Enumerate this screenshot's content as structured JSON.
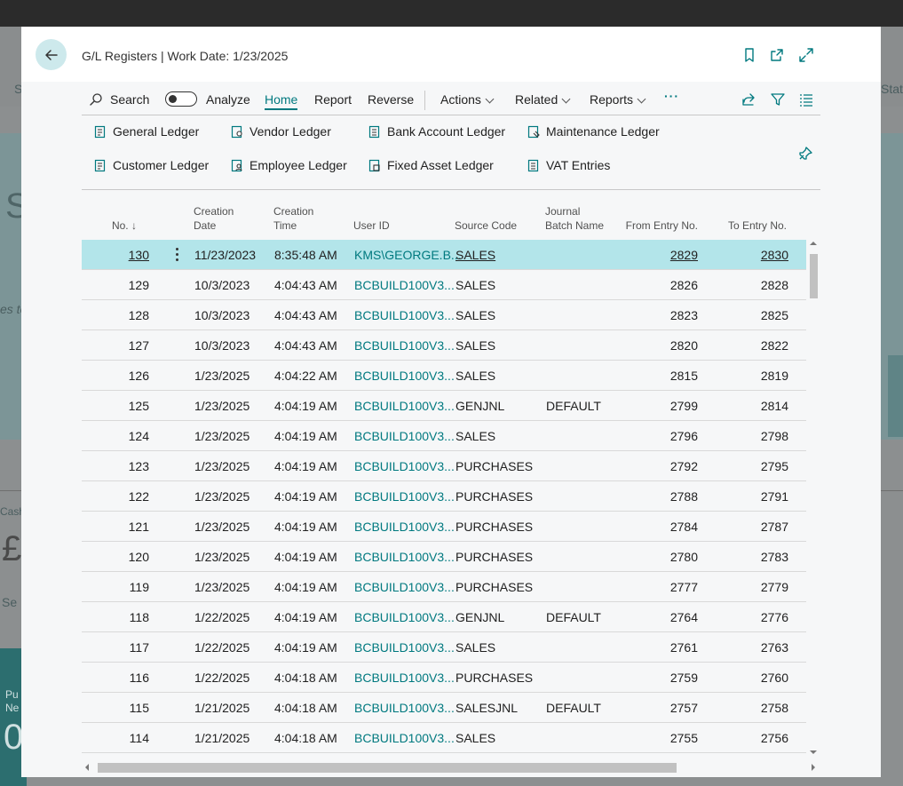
{
  "modal": {
    "title": "G/L Registers | Work Date: 1/23/2025"
  },
  "background": {
    "items": [
      "St",
      "Stat",
      "S",
      "es to",
      "Cash",
      "£",
      "Se",
      "Pu",
      "Ne",
      "0"
    ]
  },
  "actions": {
    "search": "Search",
    "analyze": "Analyze",
    "tabs": [
      "Home",
      "Report",
      "Reverse"
    ],
    "menus": [
      "Actions",
      "Related",
      "Reports"
    ],
    "more": "···"
  },
  "promoted": [
    "General Ledger",
    "Vendor Ledger",
    "Bank Account Ledger",
    "Maintenance Ledger",
    "Customer Ledger",
    "Employee Ledger",
    "Fixed Asset Ledger",
    "VAT Entries"
  ],
  "columns": {
    "no": "No.",
    "sort_indicator": "↓",
    "creation_date": [
      "Creation",
      "Date"
    ],
    "creation_time": [
      "Creation",
      "Time"
    ],
    "user_id": "User ID",
    "source_code": "Source Code",
    "journal_batch": [
      "Journal",
      "Batch Name"
    ],
    "from_entry": "From Entry No.",
    "to_entry": "To Entry No."
  },
  "rows": [
    {
      "no": "130",
      "date": "11/23/2023",
      "time": "8:35:48 AM",
      "user": "KMS\\GEORGE.B...",
      "source": "SALES",
      "batch": "",
      "from": "2829",
      "to": "2830"
    },
    {
      "no": "129",
      "date": "10/3/2023",
      "time": "4:04:43 AM",
      "user": "BCBUILD100V3...",
      "source": "SALES",
      "batch": "",
      "from": "2826",
      "to": "2828"
    },
    {
      "no": "128",
      "date": "10/3/2023",
      "time": "4:04:43 AM",
      "user": "BCBUILD100V3...",
      "source": "SALES",
      "batch": "",
      "from": "2823",
      "to": "2825"
    },
    {
      "no": "127",
      "date": "10/3/2023",
      "time": "4:04:43 AM",
      "user": "BCBUILD100V3...",
      "source": "SALES",
      "batch": "",
      "from": "2820",
      "to": "2822"
    },
    {
      "no": "126",
      "date": "1/23/2025",
      "time": "4:04:22 AM",
      "user": "BCBUILD100V3...",
      "source": "SALES",
      "batch": "",
      "from": "2815",
      "to": "2819"
    },
    {
      "no": "125",
      "date": "1/23/2025",
      "time": "4:04:19 AM",
      "user": "BCBUILD100V3...",
      "source": "GENJNL",
      "batch": "DEFAULT",
      "from": "2799",
      "to": "2814"
    },
    {
      "no": "124",
      "date": "1/23/2025",
      "time": "4:04:19 AM",
      "user": "BCBUILD100V3...",
      "source": "SALES",
      "batch": "",
      "from": "2796",
      "to": "2798"
    },
    {
      "no": "123",
      "date": "1/23/2025",
      "time": "4:04:19 AM",
      "user": "BCBUILD100V3...",
      "source": "PURCHASES",
      "batch": "",
      "from": "2792",
      "to": "2795"
    },
    {
      "no": "122",
      "date": "1/23/2025",
      "time": "4:04:19 AM",
      "user": "BCBUILD100V3...",
      "source": "PURCHASES",
      "batch": "",
      "from": "2788",
      "to": "2791"
    },
    {
      "no": "121",
      "date": "1/23/2025",
      "time": "4:04:19 AM",
      "user": "BCBUILD100V3...",
      "source": "PURCHASES",
      "batch": "",
      "from": "2784",
      "to": "2787"
    },
    {
      "no": "120",
      "date": "1/23/2025",
      "time": "4:04:19 AM",
      "user": "BCBUILD100V3...",
      "source": "PURCHASES",
      "batch": "",
      "from": "2780",
      "to": "2783"
    },
    {
      "no": "119",
      "date": "1/23/2025",
      "time": "4:04:19 AM",
      "user": "BCBUILD100V3...",
      "source": "PURCHASES",
      "batch": "",
      "from": "2777",
      "to": "2779"
    },
    {
      "no": "118",
      "date": "1/22/2025",
      "time": "4:04:19 AM",
      "user": "BCBUILD100V3...",
      "source": "GENJNL",
      "batch": "DEFAULT",
      "from": "2764",
      "to": "2776"
    },
    {
      "no": "117",
      "date": "1/22/2025",
      "time": "4:04:19 AM",
      "user": "BCBUILD100V3...",
      "source": "SALES",
      "batch": "",
      "from": "2761",
      "to": "2763"
    },
    {
      "no": "116",
      "date": "1/22/2025",
      "time": "4:04:18 AM",
      "user": "BCBUILD100V3...",
      "source": "PURCHASES",
      "batch": "",
      "from": "2759",
      "to": "2760"
    },
    {
      "no": "115",
      "date": "1/21/2025",
      "time": "4:04:18 AM",
      "user": "BCBUILD100V3...",
      "source": "SALESJNL",
      "batch": "DEFAULT",
      "from": "2757",
      "to": "2758"
    },
    {
      "no": "114",
      "date": "1/21/2025",
      "time": "4:04:18 AM",
      "user": "BCBUILD100V3...",
      "source": "SALES",
      "batch": "",
      "from": "2755",
      "to": "2756"
    }
  ],
  "colors": {
    "accent": "#00797f",
    "selected_row": "#b3e5ea",
    "back_button": "#cde9ec"
  }
}
